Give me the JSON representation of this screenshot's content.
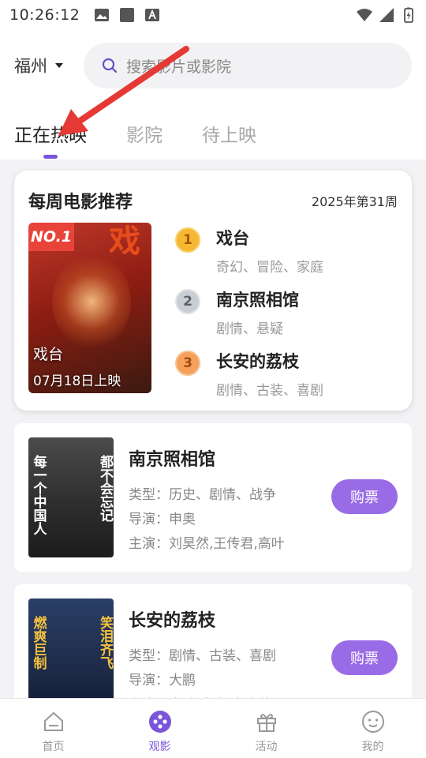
{
  "status_bar": {
    "time": "10:26:12"
  },
  "header": {
    "city": "福州",
    "search_placeholder": "搜索影片或影院",
    "tabs": [
      {
        "label": "正在热映",
        "active": true
      },
      {
        "label": "影院",
        "active": false
      },
      {
        "label": "待上映",
        "active": false
      }
    ]
  },
  "weekly": {
    "title": "每周电影推荐",
    "week": "2025年第31周",
    "featured": {
      "badge": "NO.1",
      "name": "戏台",
      "release": "07月18日上映",
      "poster_char": "戏"
    },
    "ranking": [
      {
        "rank": "1",
        "title": "戏台",
        "genre": "奇幻、冒险、家庭"
      },
      {
        "rank": "2",
        "title": "南京照相馆",
        "genre": "剧情、悬疑"
      },
      {
        "rank": "3",
        "title": "长安的荔枝",
        "genre": "剧情、古装、喜剧"
      }
    ]
  },
  "movies": [
    {
      "name": "南京照相馆",
      "type": "类型：历史、剧情、战争",
      "director": "导演：申奥",
      "cast": "主演：刘昊然,王传君,高叶",
      "buy_label": "购票",
      "poster_left": "每一个中国人",
      "poster_right": "都不会忘记"
    },
    {
      "name": "长安的荔枝",
      "type": "类型：剧情、古装、喜剧",
      "director": "导演：大鹏",
      "cast": "主演：大鹏,白客,庞达茹",
      "buy_label": "购票",
      "poster_left": "燃爽巨制",
      "poster_right": "笑泪齐飞"
    }
  ],
  "bottom_nav": [
    {
      "label": "首页",
      "icon": "home-icon",
      "active": false
    },
    {
      "label": "观影",
      "icon": "film-reel-icon",
      "active": true
    },
    {
      "label": "活动",
      "icon": "gift-icon",
      "active": false
    },
    {
      "label": "我的",
      "icon": "smiley-icon",
      "active": false
    }
  ],
  "colors": {
    "accent": "#7b55d9",
    "buy_button": "#9a6be6",
    "badge_red": "#e8443a",
    "arrow": "#e53935"
  }
}
